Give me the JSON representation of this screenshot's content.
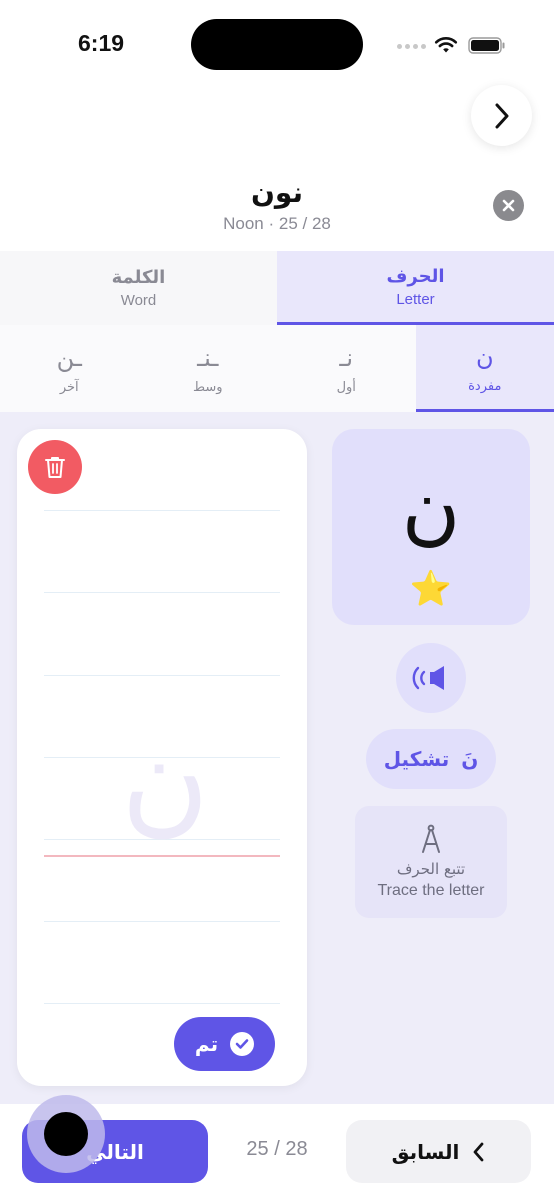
{
  "status_bar": {
    "time": "6:19"
  },
  "header": {
    "title": "نون",
    "subtitle": "Noon · 25 / 28"
  },
  "tabs": [
    {
      "ar": "الكلمة",
      "en": "Word",
      "active": false
    },
    {
      "ar": "الحرف",
      "en": "Letter",
      "active": true
    }
  ],
  "forms": [
    {
      "glyph": "ـن",
      "label": "آخر",
      "active": false
    },
    {
      "glyph": "ـنـ",
      "label": "وسط",
      "active": false
    },
    {
      "glyph": "نـ",
      "label": "أول",
      "active": false
    },
    {
      "glyph": "ن",
      "label": "مفردة",
      "active": true
    }
  ],
  "letter_card": {
    "letter": "ن",
    "star": "⭐"
  },
  "canvas": {
    "trace_glyph": "ن",
    "done_label": "تم"
  },
  "tashkeel": {
    "mark": "نَ",
    "label": "تشكيل"
  },
  "trace": {
    "ar": "تتبع الحرف",
    "en": "Trace the letter"
  },
  "footer": {
    "next_label": "التالي",
    "counter": "25 / 28",
    "prev_label": "السابق"
  },
  "colors": {
    "accent": "#5f55e6",
    "accent_light": "#e1dffb",
    "danger": "#f25b63"
  },
  "icons": [
    "chevron-right-icon",
    "close-icon",
    "trash-icon",
    "speaker-icon",
    "compass-icon",
    "check-icon",
    "chevron-left-icon"
  ]
}
